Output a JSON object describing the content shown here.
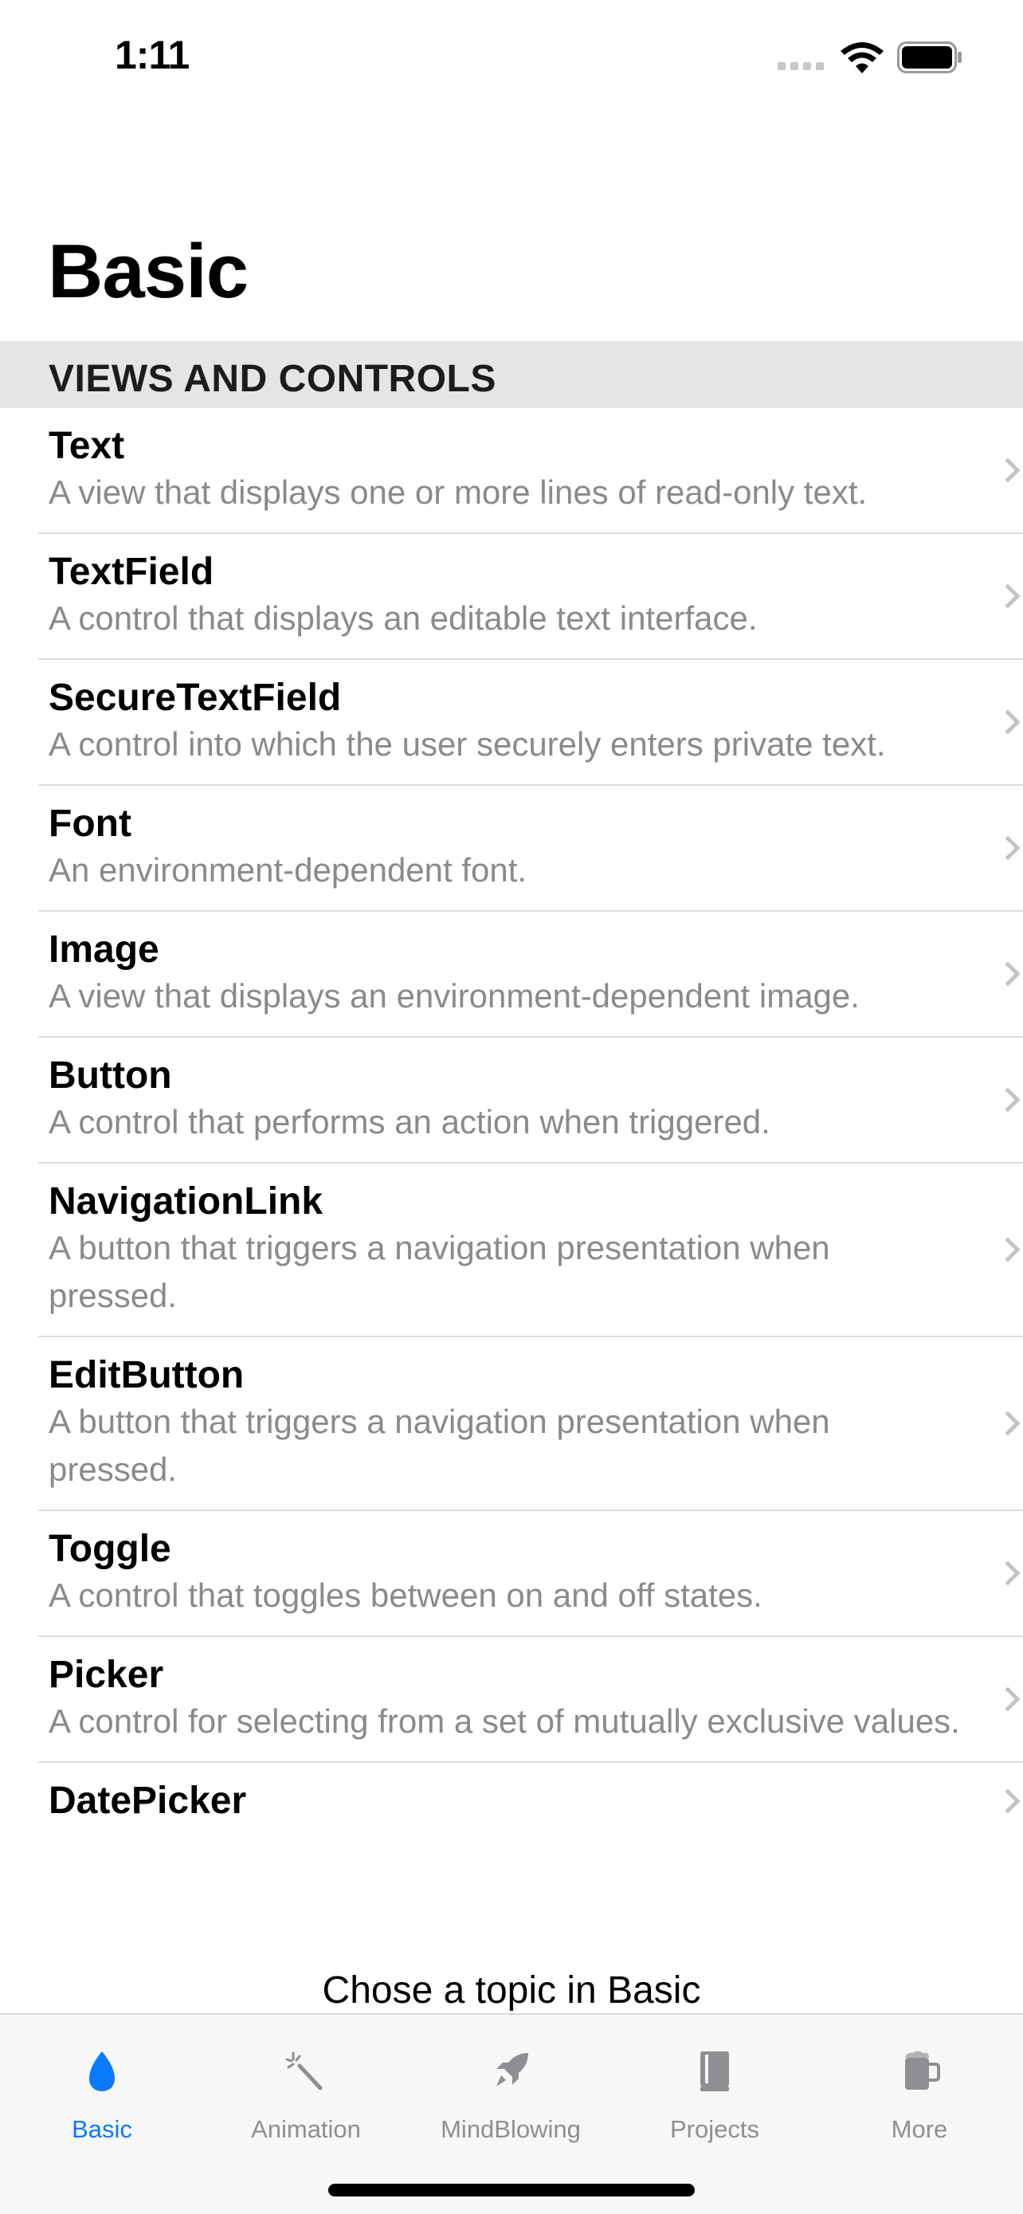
{
  "status_bar": {
    "time": "1:11"
  },
  "navigation": {
    "title": "Basic"
  },
  "section": {
    "header": "VIEWS AND CONTROLS"
  },
  "list": {
    "items": [
      {
        "title": "Text",
        "description": "A view that displays one or more lines of read-only text."
      },
      {
        "title": "TextField",
        "description": "A control that displays an editable text interface."
      },
      {
        "title": "SecureTextField",
        "description": "A control into which the user securely enters private text."
      },
      {
        "title": "Font",
        "description": "An environment-dependent font."
      },
      {
        "title": "Image",
        "description": "A view that displays an environment-dependent image."
      },
      {
        "title": "Button",
        "description": "A control that performs an action when triggered."
      },
      {
        "title": "NavigationLink",
        "description": "A button that triggers a navigation presentation when pressed."
      },
      {
        "title": "EditButton",
        "description": "A button that triggers a navigation presentation when pressed."
      },
      {
        "title": "Toggle",
        "description": "A control that toggles between on and off states."
      },
      {
        "title": "Picker",
        "description": "A control for selecting from a set of mutually exclusive values."
      },
      {
        "title": "DatePicker",
        "description": ""
      }
    ]
  },
  "detail_prompt": "Chose a topic in Basic",
  "tab_bar": {
    "tabs": [
      {
        "label": "Basic",
        "icon": "drop-icon",
        "active": true
      },
      {
        "label": "Animation",
        "icon": "magic-wand-icon",
        "active": false
      },
      {
        "label": "MindBlowing",
        "icon": "rocket-icon",
        "active": false
      },
      {
        "label": "Projects",
        "icon": "book-icon",
        "active": false
      },
      {
        "label": "More",
        "icon": "mug-icon",
        "active": false
      }
    ]
  },
  "colors": {
    "accent": "#0a7aff",
    "inactive_tab": "#8e8e93",
    "section_background": "#e5e5e5",
    "secondary_text": "#8a8a8e"
  }
}
